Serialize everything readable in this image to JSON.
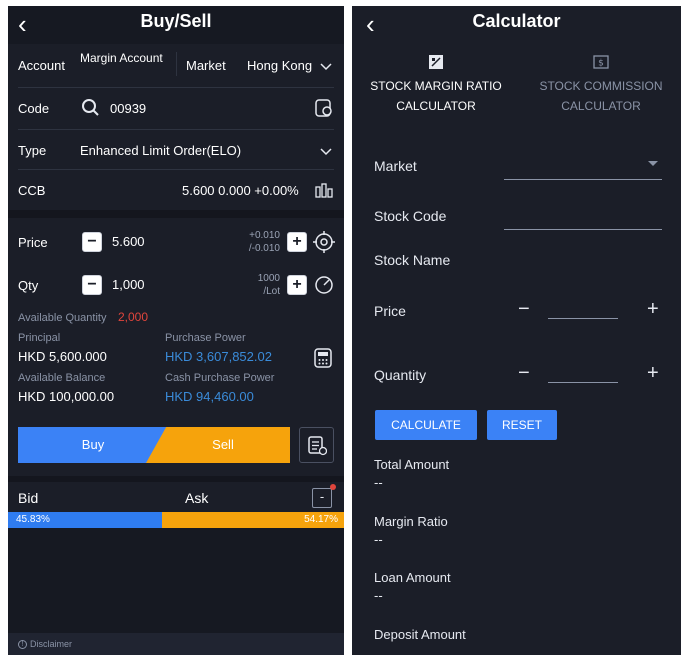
{
  "left": {
    "header": {
      "back_glyph": "‹",
      "title": "Buy/Sell"
    },
    "account": {
      "label": "Account",
      "value": "Margin Account",
      "market_label": "Market",
      "market_value": "Hong Kong"
    },
    "code": {
      "label": "Code",
      "value": "00939"
    },
    "type": {
      "label": "Type",
      "value": "Enhanced Limit Order(ELO)"
    },
    "ccb": {
      "label": "CCB",
      "value": "5.600 0.000 +0.00%"
    },
    "price": {
      "label": "Price",
      "value": "5.600",
      "step_up": "+0.010",
      "step_down": "/-0.010"
    },
    "qty": {
      "label": "Qty",
      "value": "1,000",
      "lot_top": "1000",
      "lot_bottom": "/Lot"
    },
    "available_quantity": {
      "label": "Available Quantity",
      "value": "2,000"
    },
    "principal": {
      "label": "Principal",
      "value": "HKD 5,600.000"
    },
    "purchase_power": {
      "label": "Purchase Power",
      "value": "HKD 3,607,852.02"
    },
    "available_balance": {
      "label": "Available Balance",
      "value": "HKD 100,000.00"
    },
    "cash_purchase_power": {
      "label": "Cash Purchase Power",
      "value": "HKD 94,460.00"
    },
    "actions": {
      "buy": "Buy",
      "sell": "Sell"
    },
    "bidask": {
      "bid": "Bid",
      "ask": "Ask",
      "bid_pct": "45.83%",
      "ask_pct": "54.17%",
      "bid_fraction": 0.4583,
      "collapse_glyph": "-"
    },
    "disclaimer": "Disclaimer"
  },
  "right": {
    "header": {
      "back_glyph": "‹",
      "title": "Calculator"
    },
    "tabs": [
      {
        "line1": "STOCK MARGIN RATIO",
        "line2": "CALCULATOR"
      },
      {
        "line1": "STOCK COMMISSION",
        "line2": "CALCULATOR"
      }
    ],
    "form": {
      "market": "Market",
      "stock_code": "Stock Code",
      "stock_name": "Stock Name",
      "price": "Price",
      "quantity": "Quantity",
      "minus": "−",
      "plus": "+"
    },
    "buttons": {
      "calculate": "CALCULATE",
      "reset": "RESET"
    },
    "results": [
      {
        "label": "Total Amount",
        "value": "--"
      },
      {
        "label": "Margin Ratio",
        "value": "--"
      },
      {
        "label": "Loan Amount",
        "value": "--"
      },
      {
        "label": "Deposit Amount",
        "value": ""
      }
    ]
  },
  "colors": {
    "accent_blue": "#3b82f6",
    "accent_orange": "#f6a30c",
    "panel_bg": "#1b1e28",
    "alert_red": "#e0453c",
    "link_blue": "#3a8bd9"
  }
}
